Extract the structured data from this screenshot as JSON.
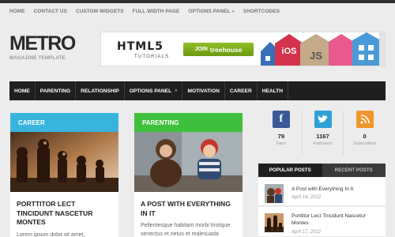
{
  "top_nav": {
    "items": [
      "HOME",
      "CONTACT US",
      "CUSTOM WIDGETS",
      "FULL WIDTH PAGE",
      "OPTIONS PANEL",
      "SHORTCODES"
    ],
    "options_arrow": "»"
  },
  "logo": {
    "title": "METRO",
    "tagline": "MAGAZINE TEMPLATE"
  },
  "banner": {
    "html5": "HTML5",
    "tutorials": "TUTORIALS",
    "join_prefix": "JOIN",
    "join_brand": "treehouse",
    "tile_labels": [
      "iOS",
      "JS"
    ]
  },
  "main_nav": {
    "items": [
      "HOME",
      "PARENTING",
      "RELATIONSHIP",
      "OPTIONS PANEL",
      "MOTIVATION",
      "CAREER",
      "HEALTH"
    ],
    "options_arrow": "»"
  },
  "cards": [
    {
      "category": "CAREER",
      "color": "#38b4de",
      "title": "PORTTITOR LECT TINCIDUNT NASCETUR MONTES",
      "excerpt": "Lorem ipsum dolor sit amet, consectetuer adipiscing elit. Curabitur"
    },
    {
      "category": "PARENTING",
      "color": "#3ec03c",
      "title": "A POST WITH EVERYTHING IN IT",
      "excerpt": "Pellentesque habitant morbi tristique senectus et netus et malesuada"
    }
  ],
  "social": [
    {
      "icon": "facebook-icon",
      "glyph": "f",
      "color": "#3b5998",
      "count": "79",
      "label": "Fans"
    },
    {
      "icon": "twitter-icon",
      "glyph": "bird",
      "color": "#2fa0d8",
      "count": "1167",
      "label": "Followers"
    },
    {
      "icon": "rss-icon",
      "glyph": "rss",
      "color": "#f0962a",
      "count": "0",
      "label": "Subscribers"
    }
  ],
  "sidebar_tabs": {
    "popular": "POPULAR POSTS",
    "recent": "RECENT POSTS"
  },
  "popular_posts": [
    {
      "title": "A Post with Everything In It",
      "date": "April 14, 2012"
    },
    {
      "title": "Porttitor Lect Tincidunt Nascetur Montes",
      "date": "April 17, 2012"
    }
  ]
}
